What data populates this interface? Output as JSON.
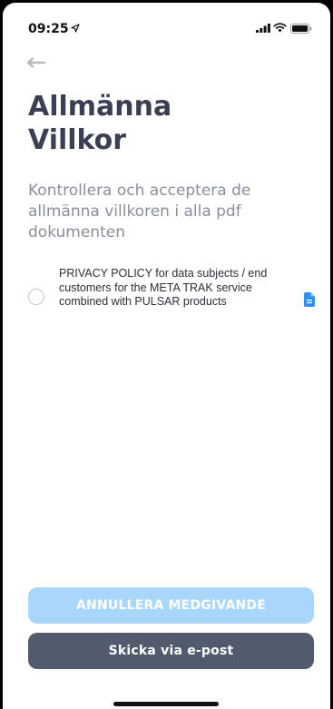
{
  "status_bar": {
    "time": "09:25",
    "location_icon": "location-arrow-icon",
    "signal_icon": "cellular-signal-icon",
    "wifi_icon": "wifi-icon",
    "battery_icon": "battery-icon"
  },
  "nav": {
    "back_icon": "back-arrow-icon"
  },
  "page": {
    "title_line1": "Allmänna",
    "title_line2": "Villkor",
    "subtitle": "Kontrollera och acceptera de allmänna villkoren i alla pdf dokumenten"
  },
  "documents": [
    {
      "title": "PRIVACY POLICY for data subjects / end customers for the META TRAK service combined with PULSAR products",
      "checked": false,
      "icon": "document-icon"
    }
  ],
  "actions": {
    "cancel_label": "ANNULLERA MEDGIVANDE",
    "email_label": "Skicka via e-post"
  },
  "colors": {
    "title": "#3a3f52",
    "subtitle": "#8a8f9c",
    "accent": "#2f8ef0",
    "cancel_button": "#a9d7fb",
    "email_button": "#525a6d"
  }
}
